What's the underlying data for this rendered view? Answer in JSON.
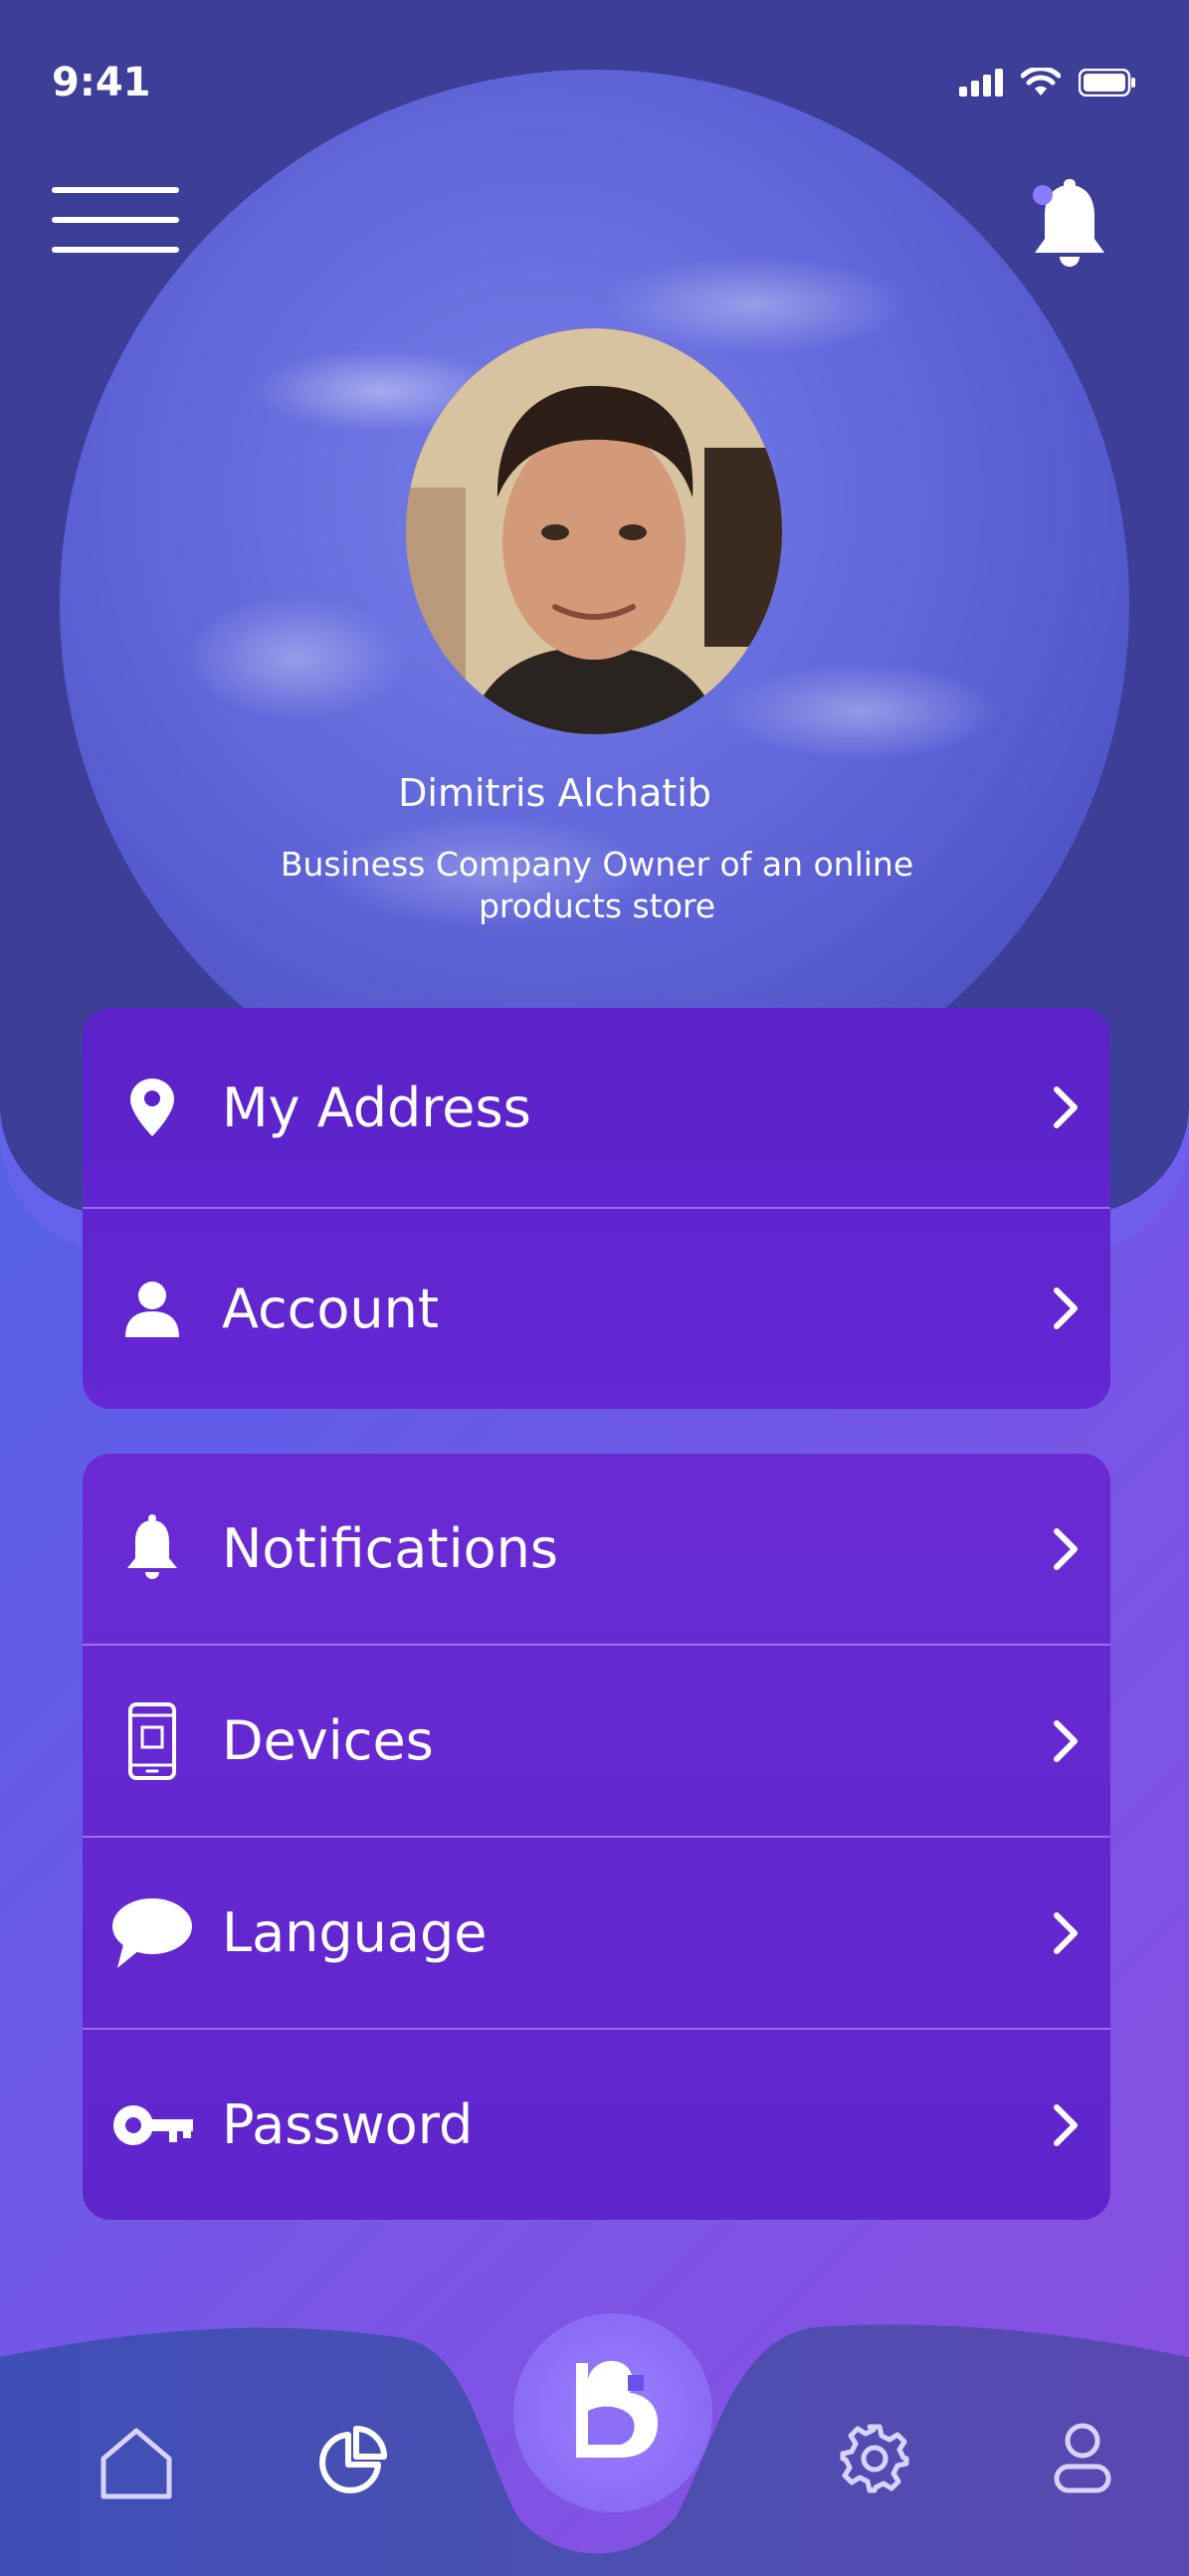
{
  "status_bar": {
    "time": "9:41"
  },
  "profile": {
    "name": "Dimitris Alchatib",
    "bio": "Business Company Owner of an online products store"
  },
  "menu_group_1": [
    {
      "label": "My Address",
      "icon": "location-pin-icon"
    },
    {
      "label": "Account",
      "icon": "user-icon"
    }
  ],
  "menu_group_2": [
    {
      "label": "Notifications",
      "icon": "bell-icon"
    },
    {
      "label": "Devices",
      "icon": "phone-icon"
    },
    {
      "label": "Language",
      "icon": "chat-bubble-icon"
    },
    {
      "label": "Password",
      "icon": "key-icon"
    }
  ],
  "bottom_nav": {
    "items": [
      "home-icon",
      "pie-chart-icon",
      "brand-logo",
      "settings-icon",
      "profile-icon"
    ],
    "active": "brand-logo"
  },
  "colors": {
    "header_bg": "#3c3e98",
    "card_bg": "#5f25cc",
    "fab_bg": "#8d6ff7",
    "notification_dot": "#8b7cff"
  }
}
